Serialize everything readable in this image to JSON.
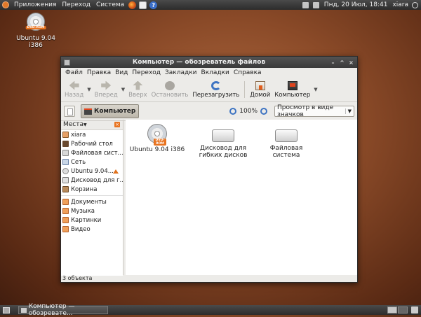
{
  "top_panel": {
    "menus": [
      "Приложения",
      "Переход",
      "Система"
    ],
    "clock": "Пнд, 20 Июл, 18:41",
    "user": "xiara",
    "help_glyph": "?"
  },
  "desktop": {
    "icon_label": "Ubuntu 9.04 i386",
    "cd_badge": "DVD-ROM"
  },
  "window": {
    "title": "Компьютер — обозреватель файлов",
    "buttons": [
      "–",
      "^",
      "×"
    ],
    "menu": [
      "Файл",
      "Правка",
      "Вид",
      "Переход",
      "Закладки",
      "Вкладки",
      "Справка"
    ],
    "toolbar": {
      "back": "Назад",
      "forward": "Вперед",
      "up": "Вверх",
      "stop": "Остановить",
      "reload": "Перезагрузить",
      "home": "Домой",
      "computer": "Компьютер"
    },
    "location": {
      "crumb": "Компьютер",
      "zoom": "100%",
      "view_mode": "Просмотр в виде значков"
    },
    "sidebar": {
      "header": "Места",
      "items": [
        {
          "label": "xiara",
          "icon": "home-icon"
        },
        {
          "label": "Рабочий стол",
          "icon": "desktop-icon"
        },
        {
          "label": "Файловая сист...",
          "icon": "filesystem-icon"
        },
        {
          "label": "Сеть",
          "icon": "network-icon"
        },
        {
          "label": "Ubuntu 9.04...",
          "icon": "cdrom-icon"
        },
        {
          "label": "Дисковод для г...",
          "icon": "floppy-icon"
        },
        {
          "label": "Корзина",
          "icon": "trash-icon"
        }
      ],
      "bookmarks": [
        {
          "label": "Документы",
          "icon": "folder-icon"
        },
        {
          "label": "Музыка",
          "icon": "folder-icon"
        },
        {
          "label": "Картинки",
          "icon": "folder-icon"
        },
        {
          "label": "Видео",
          "icon": "folder-icon"
        }
      ]
    },
    "files": [
      {
        "label": "Ubuntu 9.04 i386",
        "icon": "cdrom-icon"
      },
      {
        "label": "Дисковод для гибких дисков",
        "icon": "floppy-drive-icon"
      },
      {
        "label": "Файловая система",
        "icon": "harddisk-icon"
      }
    ],
    "status": "3 объекта"
  },
  "bottom_panel": {
    "task": "Компьютер — обозревате..."
  }
}
